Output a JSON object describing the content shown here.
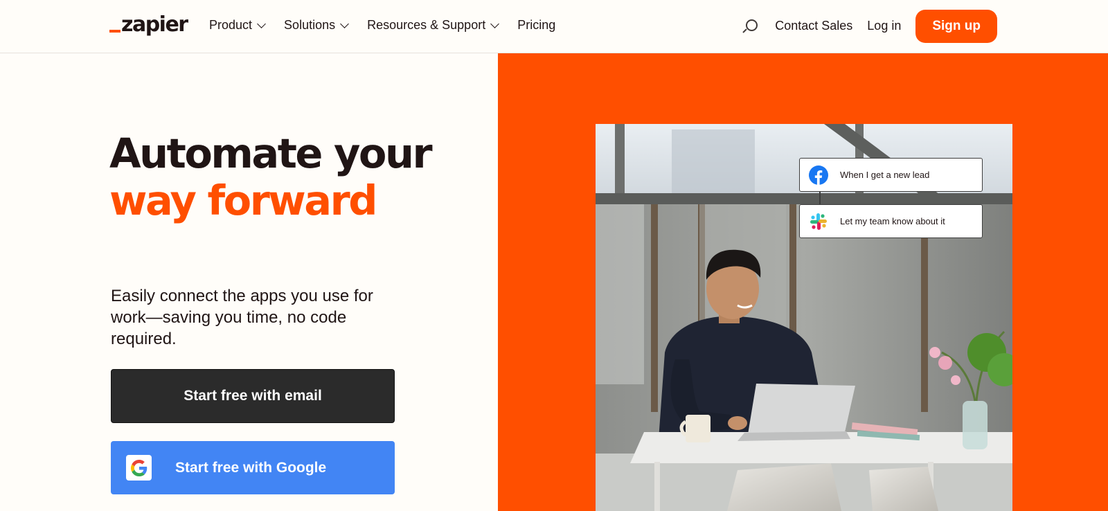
{
  "header": {
    "logo_text": "zapier",
    "nav": {
      "product": "Product",
      "solutions": "Solutions",
      "resources": "Resources & Support",
      "pricing": "Pricing"
    },
    "contact_sales": "Contact Sales",
    "log_in": "Log in",
    "sign_up": "Sign up"
  },
  "hero": {
    "title_line1": "Automate your",
    "title_line2": "way forward",
    "subtitle": "Easily connect the apps you use for work—saving you time, no code required.",
    "cta_email": "Start free with email",
    "cta_google": "Start free with Google"
  },
  "workflow": {
    "trigger": "When I get a new lead",
    "action": "Let my team know about it"
  },
  "icons": {
    "search": "search-icon",
    "facebook": "facebook-icon",
    "slack": "slack-icon",
    "google": "google-icon"
  },
  "colors": {
    "brand_orange": "#ff4f00",
    "dark_button": "#2b2b2b",
    "google_blue": "#4285f4",
    "background": "#fffdf9"
  }
}
